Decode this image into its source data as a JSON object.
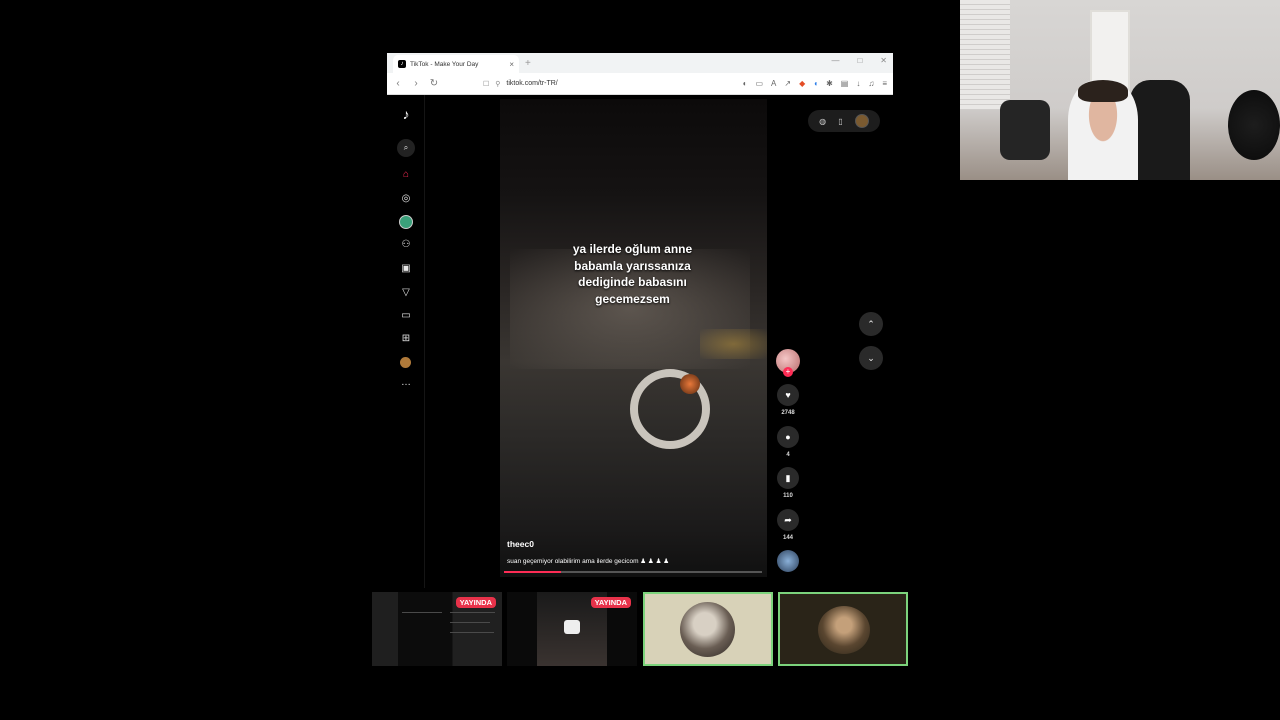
{
  "browser": {
    "tab_title": "TikTok - Make Your Day",
    "url": "tiktok.com/tr-TR/"
  },
  "tiktok": {
    "caption_lines": [
      "ya ilerde oğlum anne",
      "babamla yarıssanıza",
      "dediginde babasını",
      "gecemezsem"
    ],
    "author": "theec0",
    "description": "suan geçemiyor olabilirim ama ilerde gecicom ♟ ♟ ♟ ♟",
    "likes": "2748",
    "comments": "4",
    "saves": "110",
    "shares": "144",
    "progress_fraction": 0.22
  },
  "thumbnails": {
    "live_badge_1": "YAYINDA",
    "live_badge_2": "YAYINDA"
  },
  "icons": [
    "tiktok-logo",
    "search",
    "home",
    "explore-compass",
    "globe",
    "people",
    "live-tv",
    "filter-triangle",
    "message",
    "upload-plus",
    "more-dots"
  ],
  "colors": {
    "accent": "#fe2c55",
    "live": "#e8324a",
    "active_border": "#7cd37c"
  }
}
